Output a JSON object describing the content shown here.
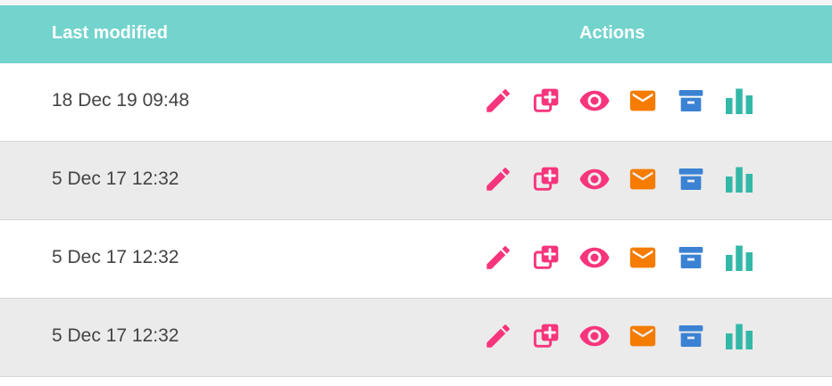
{
  "table": {
    "headers": {
      "last_modified": "Last modified",
      "actions": "Actions"
    },
    "rows": [
      {
        "last_modified": "18 Dec 19 09:48"
      },
      {
        "last_modified": "5 Dec 17 12:32"
      },
      {
        "last_modified": "5 Dec 17 12:32"
      },
      {
        "last_modified": "5 Dec 17 12:32"
      }
    ],
    "action_icons": [
      "pencil-icon",
      "duplicate-icon",
      "eye-icon",
      "envelope-icon",
      "archive-icon",
      "bar-chart-icon"
    ]
  },
  "colors": {
    "header_bg": "#73d3cd",
    "pink": "#f7357c",
    "orange": "#f57c00",
    "blue": "#3b82d3",
    "teal": "#33b8a8"
  }
}
